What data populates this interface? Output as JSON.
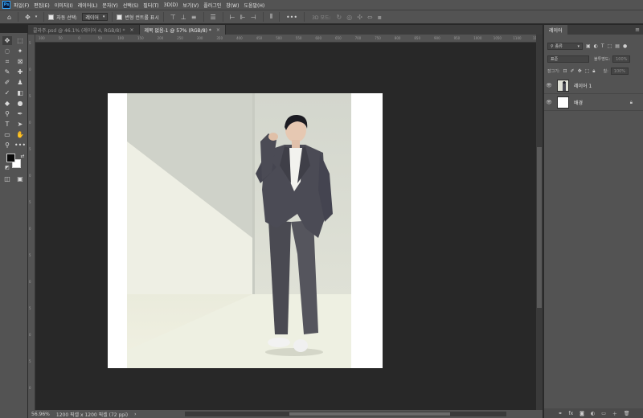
{
  "app": {
    "logo_text": "Ps"
  },
  "menubar": {
    "items": [
      "파일(F)",
      "편집(E)",
      "이미지(I)",
      "레이어(L)",
      "문자(Y)",
      "선택(S)",
      "필터(T)",
      "3D(D)",
      "보기(V)",
      "플러그인",
      "창(W)",
      "도움말(H)"
    ]
  },
  "options": {
    "auto_select_label": "자동 선택:",
    "auto_select_target": "레이어",
    "show_transform_label": "변형 컨트롤 표시",
    "mode_3d_label": "3D 모드:"
  },
  "tabs": [
    {
      "label": "콜라주.psd @ 46.1% (레이어 4, RGB/8) *",
      "active": false
    },
    {
      "label": "제목 없음-1 @ 57% (RGB/8) *",
      "active": true
    }
  ],
  "ruler": {
    "top_ticks": [
      "100",
      "50",
      "0",
      "50",
      "100",
      "150",
      "200",
      "250",
      "300",
      "350",
      "400",
      "450",
      "500",
      "550",
      "600",
      "650",
      "700",
      "750",
      "800",
      "850",
      "900",
      "950",
      "1000",
      "1050",
      "1100",
      "1150",
      "1200"
    ],
    "left_ticks": [
      "5",
      "0",
      "5",
      "0",
      "5",
      "0",
      "5",
      "0",
      "5",
      "0",
      "5",
      "0",
      "5",
      "0"
    ]
  },
  "status": {
    "zoom": "56.96%",
    "doc_info": "1200 픽셀 x 1200 픽셀 (72 ppi)"
  },
  "layers_panel": {
    "tab_label": "레이어",
    "filter_label": "종류",
    "blend_mode": "표준",
    "opacity_label": "불투명도:",
    "opacity_value": "100%",
    "lock_label": "잠그기:",
    "fill_label": "칠:",
    "fill_value": "100%",
    "layers": [
      {
        "name": "레이어 1",
        "visible": true,
        "locked": false
      },
      {
        "name": "배경",
        "visible": true,
        "locked": true
      }
    ]
  },
  "colors": {
    "foreground": "#0a0a0a",
    "background": "#ffffff",
    "accent": "#31a8ff"
  }
}
